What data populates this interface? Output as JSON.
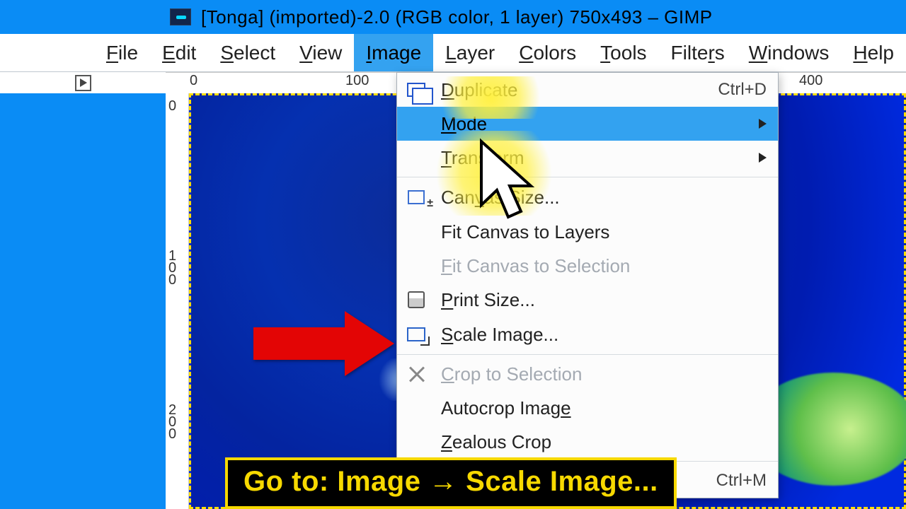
{
  "title": "[Tonga] (imported)-2.0 (RGB color, 1 layer) 750x493 – GIMP",
  "menubar": {
    "file": "File",
    "edit": "Edit",
    "select": "Select",
    "view": "View",
    "image": "Image",
    "layer": "Layer",
    "colors": "Colors",
    "tools": "Tools",
    "filters": "Filters",
    "windows": "Windows",
    "help": "Help"
  },
  "hruler": {
    "t0": "0",
    "t100": "100",
    "t400": "400"
  },
  "vruler": {
    "t0": "0",
    "t100": "100",
    "t200": "200"
  },
  "dropdown": {
    "duplicate": "Duplicate",
    "duplicate_sc": "Ctrl+D",
    "mode": "Mode",
    "transform": "Transform",
    "canvas_size": "Canvas Size...",
    "fit_layers": "Fit Canvas to Layers",
    "fit_selection": "Fit Canvas to Selection",
    "print_size": "Print Size...",
    "scale_image": "Scale Image...",
    "crop_sel": "Crop to Selection",
    "autocrop": "Autocrop Image",
    "zealous": "Zealous Crop",
    "flatten_sc": "Ctrl+M"
  },
  "caption": "Go to: Image → Scale Image..."
}
